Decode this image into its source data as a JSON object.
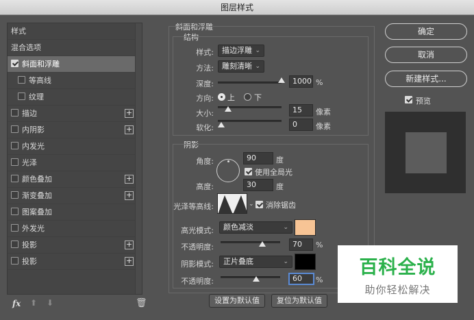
{
  "window": {
    "title": "图层样式"
  },
  "style_list": {
    "items": [
      {
        "label": "样式",
        "checkbox": false,
        "plus": false,
        "selected": false,
        "sub": false
      },
      {
        "label": "混合选项",
        "checkbox": false,
        "plus": false,
        "selected": false,
        "sub": false
      },
      {
        "label": "斜面和浮雕",
        "checkbox": true,
        "checked": true,
        "plus": false,
        "selected": true,
        "sub": false
      },
      {
        "label": "等高线",
        "checkbox": true,
        "checked": false,
        "plus": false,
        "selected": false,
        "sub": true
      },
      {
        "label": "纹理",
        "checkbox": true,
        "checked": false,
        "plus": false,
        "selected": false,
        "sub": true
      },
      {
        "label": "描边",
        "checkbox": true,
        "checked": false,
        "plus": true,
        "selected": false,
        "sub": false
      },
      {
        "label": "内阴影",
        "checkbox": true,
        "checked": false,
        "plus": true,
        "selected": false,
        "sub": false
      },
      {
        "label": "内发光",
        "checkbox": true,
        "checked": false,
        "plus": false,
        "selected": false,
        "sub": false
      },
      {
        "label": "光泽",
        "checkbox": true,
        "checked": false,
        "plus": false,
        "selected": false,
        "sub": false
      },
      {
        "label": "颜色叠加",
        "checkbox": true,
        "checked": false,
        "plus": true,
        "selected": false,
        "sub": false
      },
      {
        "label": "渐变叠加",
        "checkbox": true,
        "checked": false,
        "plus": true,
        "selected": false,
        "sub": false
      },
      {
        "label": "图案叠加",
        "checkbox": true,
        "checked": false,
        "plus": false,
        "selected": false,
        "sub": false
      },
      {
        "label": "外发光",
        "checkbox": true,
        "checked": false,
        "plus": false,
        "selected": false,
        "sub": false
      },
      {
        "label": "投影",
        "checkbox": true,
        "checked": false,
        "plus": true,
        "selected": false,
        "sub": false
      },
      {
        "label": "投影",
        "checkbox": true,
        "checked": false,
        "plus": true,
        "selected": false,
        "sub": false
      }
    ],
    "plus_glyph": "+",
    "fx_label": "fx",
    "up_glyph": "⬆",
    "down_glyph": "⬇",
    "trash_glyph": "🗑"
  },
  "bevel": {
    "section_title": "斜面和浮雕",
    "structure": {
      "title": "结构",
      "style_label": "样式:",
      "style_value": "描边浮雕",
      "method_label": "方法:",
      "method_value": "雕刻清晰",
      "depth_label": "深度:",
      "depth_value": "1000",
      "depth_unit": "%",
      "depth_fraction": 1.0,
      "direction_label": "方向:",
      "direction_up": "上",
      "direction_down": "下",
      "direction_selected": "上",
      "size_label": "大小:",
      "size_value": "15",
      "size_unit": "像素",
      "size_fraction": 0.06,
      "soften_label": "软化:",
      "soften_value": "0",
      "soften_unit": "像素",
      "soften_fraction": 0.0
    },
    "shading": {
      "title": "阴影",
      "angle_label": "角度:",
      "angle_value": "90",
      "angle_unit": "度",
      "global_light_label": "使用全局光",
      "global_light_checked": true,
      "altitude_label": "高度:",
      "altitude_value": "30",
      "altitude_unit": "度",
      "gloss_contour_label": "光泽等高线:",
      "anti_alias_label": "消除锯齿",
      "anti_alias_checked": true,
      "highlight_mode_label": "高光模式:",
      "highlight_mode_value": "颜色减淡",
      "highlight_color": "#f7c495",
      "highlight_opacity_label": "不透明度:",
      "highlight_opacity_value": "70",
      "highlight_opacity_unit": "%",
      "highlight_opacity_fraction": 0.7,
      "shadow_mode_label": "阴影模式:",
      "shadow_mode_value": "正片叠底",
      "shadow_color": "#000000",
      "shadow_opacity_label": "不透明度:",
      "shadow_opacity_value": "60",
      "shadow_opacity_unit": "%",
      "shadow_opacity_fraction": 0.6
    },
    "make_default_label": "设置为默认值",
    "reset_default_label": "复位为默认值"
  },
  "actions": {
    "ok_label": "确定",
    "cancel_label": "取消",
    "new_style_label": "新建样式...",
    "preview_label": "预览",
    "preview_checked": true
  },
  "watermark": {
    "title": "百科全说",
    "subtitle": "助你轻松解决"
  }
}
